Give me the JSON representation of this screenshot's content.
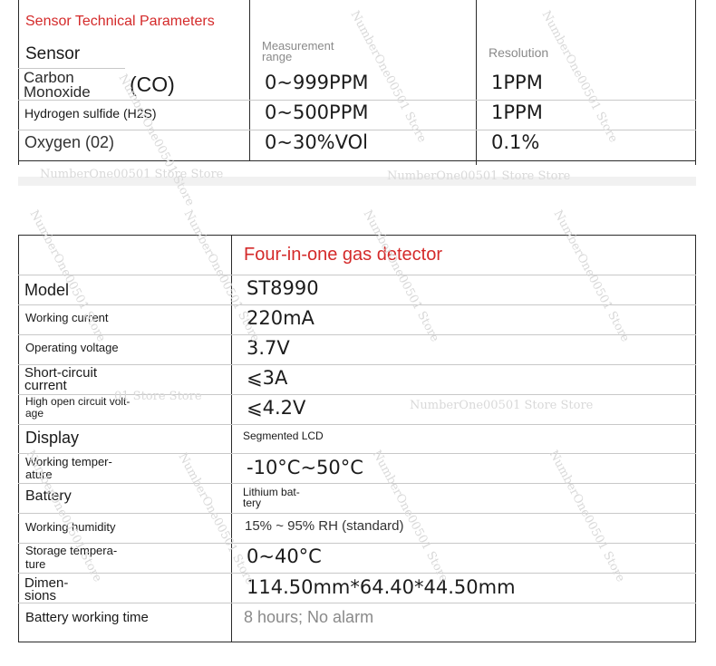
{
  "sensor_table": {
    "title": "Sensor Technical Parameters",
    "headers": {
      "sensor": "Sensor",
      "range_l1": "Measurement",
      "range_l2": "range",
      "resolution": "Resolution"
    },
    "rows": [
      {
        "name_l1": "Carbon",
        "name_l2": "Monoxide",
        "name_suffix": "(CO)",
        "range": "0~999PPM",
        "resolution": "1PPM"
      },
      {
        "name": "Hydrogen sulfide (H2S)",
        "range": "0~500PPM",
        "resolution": "1PPM"
      },
      {
        "name": "Oxygen (02)",
        "range": "0~30%VOl",
        "resolution": "0.1%"
      }
    ]
  },
  "spec_table": {
    "title": "Four-in-one gas detector",
    "rows": [
      {
        "label": "Model",
        "value": "ST8990"
      },
      {
        "label": "Working current",
        "value": "220mA"
      },
      {
        "label": "Operating voltage",
        "value": "3.7V"
      },
      {
        "label_l1": "Short-circuit",
        "label_l2": "current",
        "value": "⩽3A"
      },
      {
        "label_l1": "High open circuit volt-",
        "label_l2": "age",
        "value": "⩽4.2V"
      },
      {
        "label": "Display",
        "value": "Segmented LCD"
      },
      {
        "label_l1": "Working temper-",
        "label_l2": "ature",
        "value": "-10°C~50°C"
      },
      {
        "label": "Battery",
        "value_l1": "Lithium bat-",
        "value_l2": "tery"
      },
      {
        "label": "Working humidity",
        "value": "15% ~ 95% RH (standard)"
      },
      {
        "label_l1": "Storage tempera-",
        "label_l2": "ture",
        "value": "0~40°C"
      },
      {
        "label_l1": "Dimen-",
        "label_l2": "sions",
        "value": "114.50mm*64.40*44.50mm"
      },
      {
        "label": "Battery working time",
        "value": "8 hours; No alarm"
      }
    ]
  },
  "watermark": {
    "text": "NumberOne00501 Store",
    "text_double": "NumberOne00501 Store Store",
    "text_partial": "01 Store Store"
  },
  "colors": {
    "title_red": "#d42a2a",
    "border": "#2a2a2a",
    "watermark": "#d9d9d9"
  }
}
